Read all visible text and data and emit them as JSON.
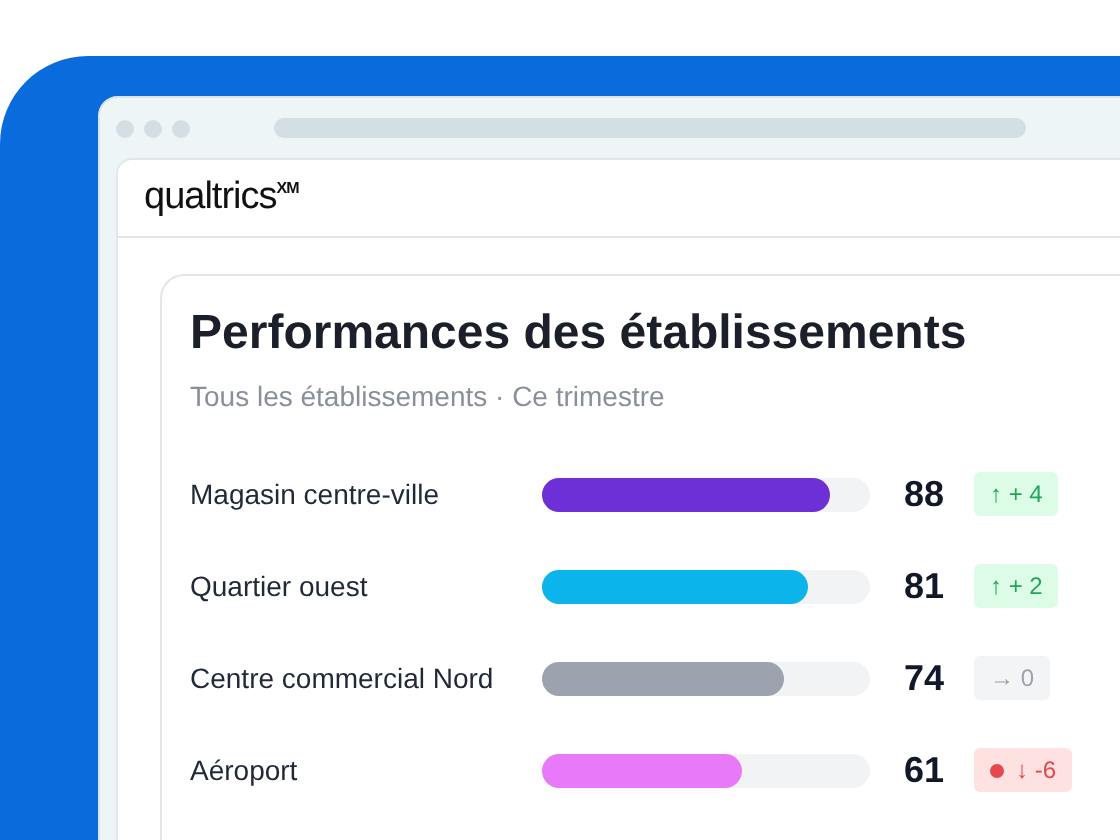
{
  "brand": {
    "name": "qualtrics",
    "mark": "XM"
  },
  "card": {
    "title": "Performances des établissements",
    "subtitle": "Tous les établissements · Ce trimestre",
    "rows": [
      {
        "name": "Magasin centre-ville",
        "level": 0.88,
        "color": "#6d2fd6",
        "score": "88",
        "change": "↑ + 4",
        "kind": "up"
      },
      {
        "name": "Quartier ouest",
        "level": 0.81,
        "color": "#0bb4ea",
        "score": "81",
        "change": "↑ + 2",
        "kind": "up"
      },
      {
        "name": "Centre commercial Nord",
        "level": 0.74,
        "color": "#9ca3af",
        "score": "74",
        "change": "→ 0",
        "kind": "flat"
      },
      {
        "name": "Aéroport",
        "level": 0.61,
        "color": "#e879f9",
        "score": "61",
        "change": "↓ -6",
        "kind": "down"
      }
    ]
  }
}
